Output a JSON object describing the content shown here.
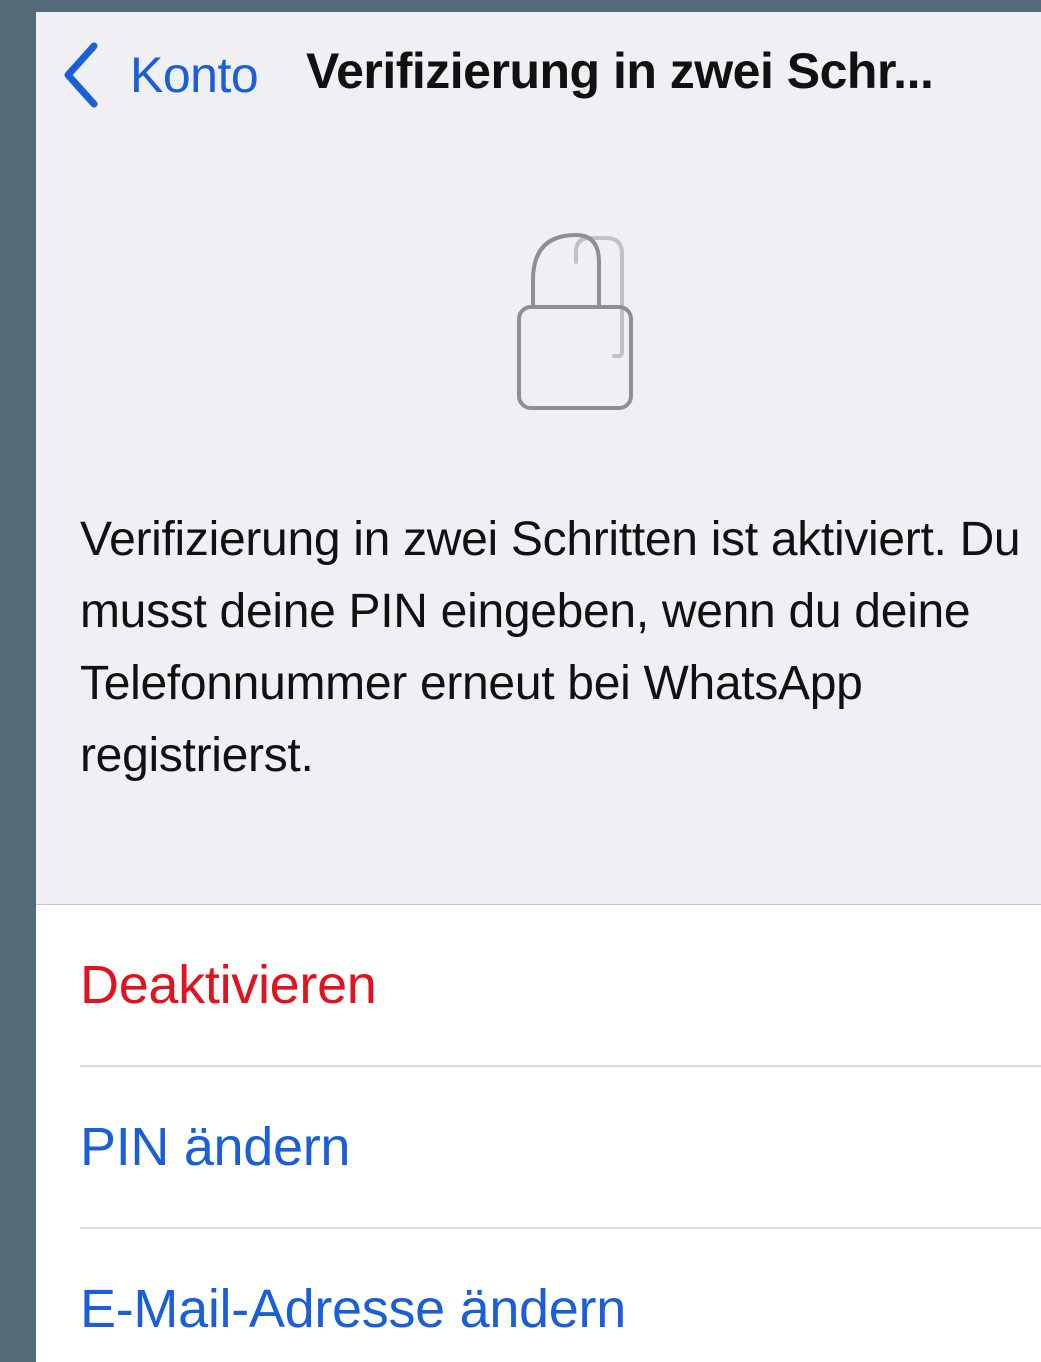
{
  "nav": {
    "back_label": "Konto",
    "title": "Verifizierung in zwei Schr..."
  },
  "icons": {
    "back": "chevron-left-icon",
    "hero": "lock-icon"
  },
  "description": "Verifizierung in zwei Schritten ist aktiviert. Du musst deine PIN eingeben, wenn du deine Telefonnummer erneut bei WhatsApp registrierst.",
  "actions": [
    {
      "label": "Deaktivieren",
      "color": "#e0131f"
    },
    {
      "label": "PIN ändern",
      "color": "#1a5fd8"
    },
    {
      "label": "E-Mail-Adresse ändern",
      "color": "#1a5fd8"
    }
  ],
  "colors": {
    "accent": "#1a5fd8",
    "destructive": "#e0131f",
    "background": "#efeff4",
    "frame": "#536b78"
  }
}
